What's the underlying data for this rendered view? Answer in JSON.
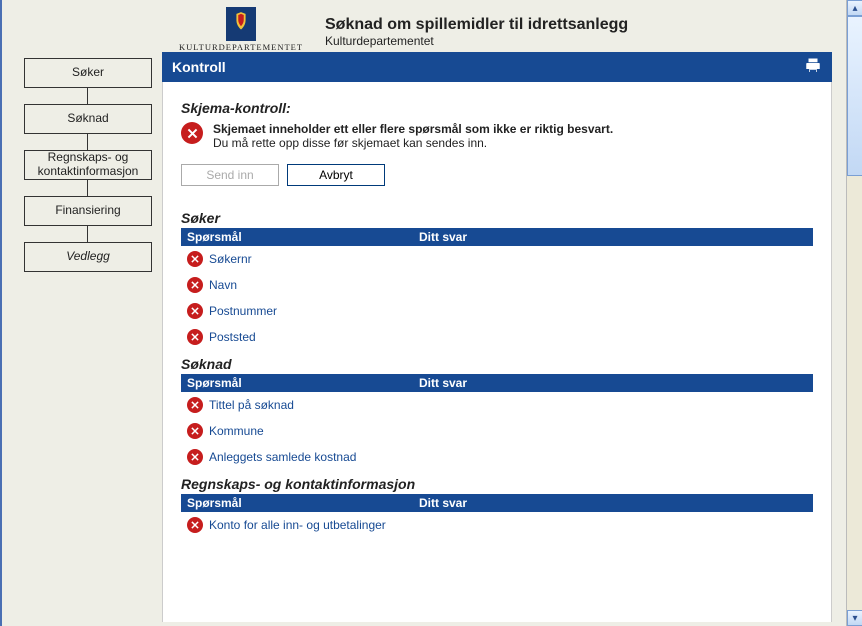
{
  "header": {
    "org_name": "KULTURDEPARTEMENTET",
    "title": "Søknad om spillemidler til idrettsanlegg",
    "subtitle": "Kulturdepartementet"
  },
  "nav": [
    {
      "label": "Søker",
      "id": "soker"
    },
    {
      "label": "Søknad",
      "id": "soknad"
    },
    {
      "label": "Regnskaps- og kontaktinformasjon",
      "id": "regnskap"
    },
    {
      "label": "Finansiering",
      "id": "finansiering"
    },
    {
      "label": "Vedlegg",
      "id": "vedlegg",
      "active": true
    }
  ],
  "panel": {
    "title": "Kontroll",
    "form_control_heading": "Skjema-kontroll:",
    "alert": {
      "line1": "Skjemaet inneholder ett eller flere spørsmål som ikke er riktig besvart.",
      "line2": "Du må rette opp disse før skjemaet kan sendes inn."
    },
    "buttons": {
      "send": "Send inn",
      "cancel": "Avbryt"
    },
    "columns": {
      "question": "Spørsmål",
      "answer": "Ditt svar"
    },
    "groups": [
      {
        "title": "Søker",
        "rows": [
          "Søkernr",
          "Navn",
          "Postnummer",
          "Poststed"
        ]
      },
      {
        "title": "Søknad",
        "rows": [
          "Tittel på søknad",
          "Kommune",
          "Anleggets samlede kostnad"
        ]
      },
      {
        "title": "Regnskaps- og kontaktinformasjon",
        "rows": [
          "Konto for alle inn- og utbetalinger"
        ]
      }
    ]
  }
}
